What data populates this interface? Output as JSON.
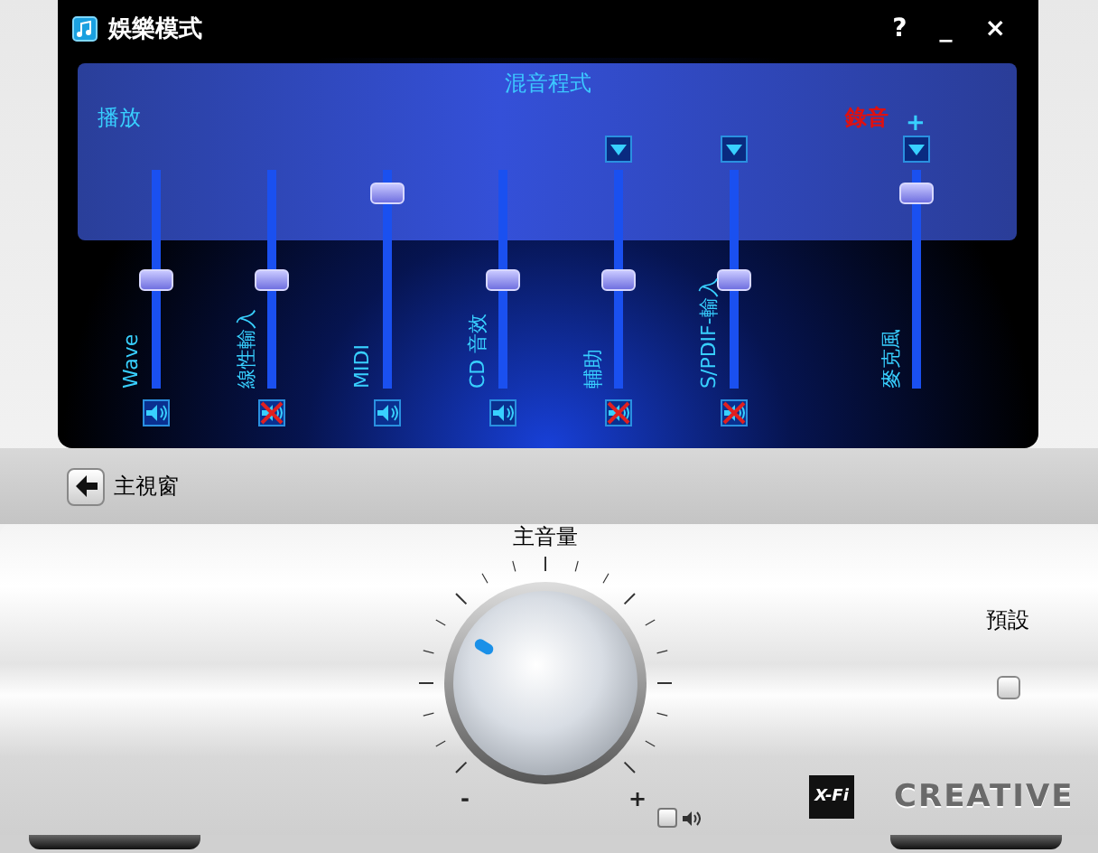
{
  "window": {
    "title": "娛樂模式",
    "help": "?",
    "minimize": "_",
    "close": "×"
  },
  "mixer": {
    "title": "混音程式",
    "playback_label": "播放",
    "record_label": "錄音",
    "channels": [
      {
        "name": "Wave",
        "level": 0.5,
        "muted": false,
        "record_source": false
      },
      {
        "name": "線性輸入",
        "level": 0.5,
        "muted": true,
        "record_source": false
      },
      {
        "name": "MIDI",
        "level": 0.94,
        "muted": false,
        "record_source": false
      },
      {
        "name": "CD 音效",
        "level": 0.5,
        "muted": false,
        "record_source": false
      },
      {
        "name": "輔助",
        "level": 0.5,
        "muted": true,
        "record_source": true
      },
      {
        "name": "S/PDIF-輸入",
        "level": 0.5,
        "muted": true,
        "record_source": true
      },
      {
        "name": "麥克風",
        "level": 0.94,
        "record_source": true,
        "boost": "+"
      }
    ]
  },
  "back_button": {
    "label": "主視窗"
  },
  "master": {
    "label": "主音量",
    "level": 0.28,
    "min_label": "-",
    "max_label": "+",
    "muted": false
  },
  "preset": {
    "label": "預設"
  },
  "logos": {
    "xfi": "X-Fi",
    "brand": "CREATIVE"
  }
}
